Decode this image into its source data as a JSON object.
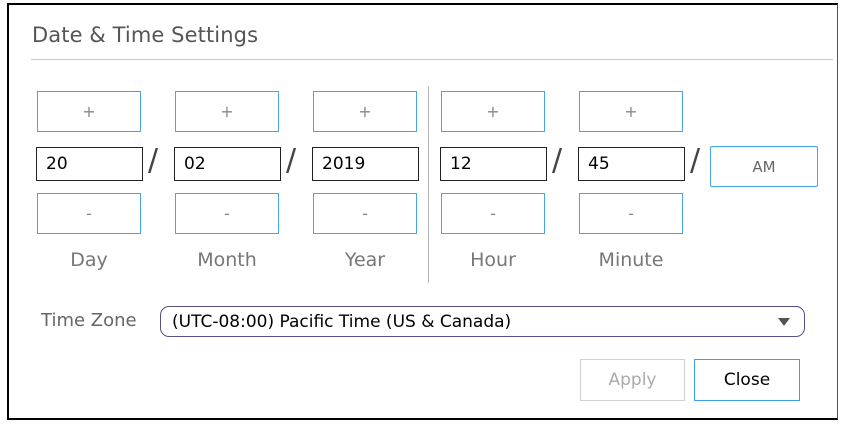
{
  "dialog": {
    "title": "Date & Time Settings"
  },
  "spinners": {
    "increment_label": "+",
    "decrement_label": "-"
  },
  "separator": "/",
  "fields": {
    "day": {
      "label": "Day",
      "value": "20"
    },
    "month": {
      "label": "Month",
      "value": "02"
    },
    "year": {
      "label": "Year",
      "value": "2019"
    },
    "hour": {
      "label": "Hour",
      "value": "12"
    },
    "minute": {
      "label": "Minute",
      "value": "45"
    }
  },
  "ampm_toggle": "AM",
  "timezone": {
    "label": "Time Zone",
    "selected": "(UTC-08:00) Pacific Time (US & Canada)"
  },
  "buttons": {
    "apply": "Apply",
    "close": "Close"
  },
  "colors": {
    "spinner_border": "#47a6e6",
    "select_border": "#5b4e8a",
    "disabled_text": "#aaaaaa"
  }
}
